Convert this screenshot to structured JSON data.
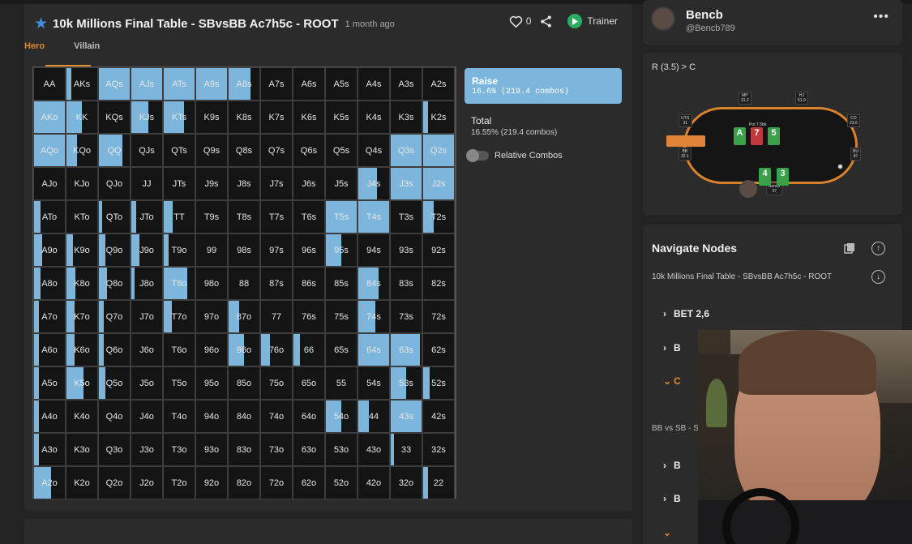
{
  "header": {
    "title": "10k Millions Final Table - SBvsBB Ac7h5c - ROOT",
    "time": "1 month ago",
    "likes": "0",
    "trainer_label": "Trainer"
  },
  "tabs": {
    "hero": "Hero",
    "villain": "Villain"
  },
  "matrix": {
    "rows": [
      [
        "AA",
        "AKs",
        "AQs",
        "AJs",
        "ATs",
        "A9s",
        "A8s",
        "A7s",
        "A6s",
        "A5s",
        "A4s",
        "A3s",
        "A2s"
      ],
      [
        "AKo",
        "KK",
        "KQs",
        "KJs",
        "KTs",
        "K9s",
        "K8s",
        "K7s",
        "K6s",
        "K5s",
        "K4s",
        "K3s",
        "K2s"
      ],
      [
        "AQo",
        "KQo",
        "QQ",
        "QJs",
        "QTs",
        "Q9s",
        "Q8s",
        "Q7s",
        "Q6s",
        "Q5s",
        "Q4s",
        "Q3s",
        "Q2s"
      ],
      [
        "AJo",
        "KJo",
        "QJo",
        "JJ",
        "JTs",
        "J9s",
        "J8s",
        "J7s",
        "J6s",
        "J5s",
        "J4s",
        "J3s",
        "J2s"
      ],
      [
        "ATo",
        "KTo",
        "QTo",
        "JTo",
        "TT",
        "T9s",
        "T8s",
        "T7s",
        "T6s",
        "T5s",
        "T4s",
        "T3s",
        "T2s"
      ],
      [
        "A9o",
        "K9o",
        "Q9o",
        "J9o",
        "T9o",
        "99",
        "98s",
        "97s",
        "96s",
        "95s",
        "94s",
        "93s",
        "92s"
      ],
      [
        "A8o",
        "K8o",
        "Q8o",
        "J8o",
        "T8o",
        "98o",
        "88",
        "87s",
        "86s",
        "85s",
        "84s",
        "83s",
        "82s"
      ],
      [
        "A7o",
        "K7o",
        "Q7o",
        "J7o",
        "T7o",
        "97o",
        "87o",
        "77",
        "76s",
        "75s",
        "74s",
        "73s",
        "72s"
      ],
      [
        "A6o",
        "K6o",
        "Q6o",
        "J6o",
        "T6o",
        "96o",
        "86o",
        "76o",
        "66",
        "65s",
        "64s",
        "63s",
        "62s"
      ],
      [
        "A5o",
        "K5o",
        "Q5o",
        "J5o",
        "T5o",
        "95o",
        "85o",
        "75o",
        "65o",
        "55",
        "54s",
        "53s",
        "52s"
      ],
      [
        "A4o",
        "K4o",
        "Q4o",
        "J4o",
        "T4o",
        "94o",
        "84o",
        "74o",
        "64o",
        "54o",
        "44",
        "43s",
        "42s"
      ],
      [
        "A3o",
        "K3o",
        "Q3o",
        "J3o",
        "T3o",
        "93o",
        "83o",
        "73o",
        "63o",
        "53o",
        "43o",
        "33",
        "32s"
      ],
      [
        "A2o",
        "K2o",
        "Q2o",
        "J2o",
        "T2o",
        "92o",
        "82o",
        "72o",
        "62o",
        "52o",
        "42o",
        "32o",
        "22"
      ]
    ],
    "raise_freq": [
      [
        0,
        0.15,
        1,
        1,
        1,
        1,
        0.7,
        0,
        0,
        0,
        0,
        0,
        0
      ],
      [
        1,
        0.5,
        0,
        0.55,
        0.65,
        0,
        0,
        0,
        0,
        0,
        0,
        0,
        0.15
      ],
      [
        1,
        0.35,
        0.75,
        0,
        0,
        0,
        0,
        0,
        0,
        0,
        0,
        1,
        1
      ],
      [
        0,
        0,
        0,
        0,
        0,
        0,
        0,
        0,
        0,
        0,
        0.6,
        1,
        1
      ],
      [
        0.2,
        0,
        0.1,
        0.15,
        0.3,
        0,
        0,
        0,
        0,
        1,
        1,
        0,
        0.35
      ],
      [
        0.25,
        0.2,
        0.2,
        0.25,
        0.15,
        0,
        0,
        0,
        0,
        0.5,
        0,
        0,
        0
      ],
      [
        0.2,
        0.3,
        0.25,
        0.1,
        0.75,
        0,
        0,
        0,
        0,
        0,
        0.65,
        0,
        0
      ],
      [
        0.15,
        0.25,
        0.15,
        0,
        0.25,
        0,
        0.35,
        0,
        0,
        0,
        0.55,
        0,
        0
      ],
      [
        0.15,
        0.25,
        0.15,
        0,
        0,
        0,
        0.5,
        0.3,
        0.2,
        0,
        1,
        0.95,
        0
      ],
      [
        0.15,
        0.55,
        0.2,
        0,
        0,
        0,
        0,
        0,
        0,
        0,
        0,
        0.5,
        0.2
      ],
      [
        0.15,
        0,
        0,
        0,
        0,
        0,
        0,
        0,
        0,
        0.5,
        0.35,
        1,
        0
      ],
      [
        0.15,
        0,
        0,
        0,
        0,
        0,
        0,
        0,
        0,
        0,
        0,
        0.1,
        0
      ],
      [
        0.55,
        0,
        0,
        0,
        0,
        0,
        0,
        0,
        0,
        0,
        0,
        0,
        0.15
      ]
    ]
  },
  "strategy": {
    "raise_title": "Raise",
    "raise_sub": "16.6% (219.4 combos)",
    "total_title": "Total",
    "total_sub": "16.55% (219.4 combos)",
    "relative_combos": "Relative Combos",
    "accent_color": "#7cb6dd"
  },
  "profile": {
    "name": "Bencb",
    "handle": "@Bencb789"
  },
  "table": {
    "path": "R (3.5) > C",
    "seats": [
      {
        "pos": "MP",
        "stack": "31.2"
      },
      {
        "pos": "HJ",
        "stack": "51.9"
      },
      {
        "pos": "UTG",
        "stack": "31"
      },
      {
        "pos": "CO",
        "stack": "23.6"
      },
      {
        "pos": "BB",
        "stack": "32.1"
      },
      {
        "pos": "BU",
        "stack": "87"
      },
      {
        "pos": "Bencb",
        "stack": "37"
      }
    ],
    "pot": "Pot 7.5bb",
    "board": [
      "A",
      "7",
      "5"
    ],
    "hero_cards": [
      "4",
      "3"
    ]
  },
  "navigate": {
    "title": "Navigate Nodes",
    "root": "10k Millions Final Table - SBvsBB Ac7h5c - ROOT",
    "nodes": [
      "BET 2,6",
      "B",
      "C"
    ],
    "bb_vs": "BB vs SB - S",
    "nodes2": [
      "B",
      "B"
    ]
  }
}
